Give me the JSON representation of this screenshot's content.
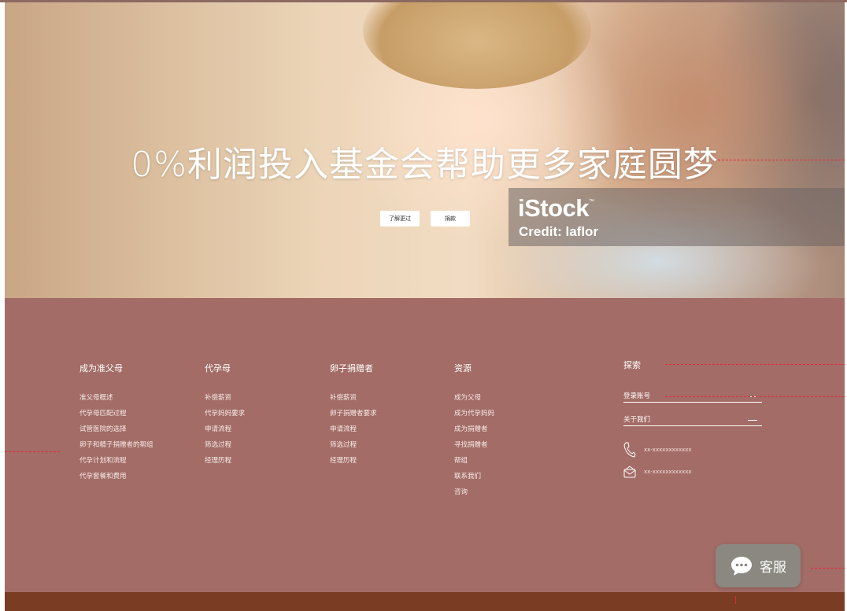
{
  "hero": {
    "title": "0%利润投入基金会帮助更多家庭圆梦",
    "learn_more_label": "了解更过",
    "donate_label": "捐款",
    "watermark": {
      "logo": "iStock",
      "trademark": "™",
      "credit": "Credit: laflor"
    }
  },
  "footer": {
    "columns": [
      {
        "title": "成为准父母",
        "items": [
          "准父母概述",
          "代孕母匹配过程",
          "试管医院的选择",
          "卵子和精子捐赠者的帮组",
          "代孕计划和流程",
          "代孕套餐和费用"
        ]
      },
      {
        "title": "代孕母",
        "items": [
          "补偿薪资",
          "代孕妈妈要求",
          "申请流程",
          "筛选过程",
          "经理历程"
        ]
      },
      {
        "title": "卵子捐赠者",
        "items": [
          "补偿薪资",
          "卵子捐赠者要求",
          "申请流程",
          "筛选过程",
          "经理历程"
        ]
      },
      {
        "title": "资源",
        "items": [
          "成为父母",
          "成为代孕妈妈",
          "成为捐赠者",
          "寻找捐赠者",
          "帮组",
          "联系我们",
          "咨询"
        ]
      }
    ],
    "explore": {
      "title": "探索",
      "login_label": "登录账号",
      "about_label": "关于我们",
      "phone": "xx-xxxxxxxxxxxx",
      "email": "xx-xxxxxxxxxxxx"
    }
  },
  "chat": {
    "label": "客服",
    "icon": "chat-bubble-icon"
  },
  "colors": {
    "footer_bg": "#a36c66",
    "bottom_bar": "#7a3c22",
    "guide": "#e8283c",
    "chat_bg": "#8a8880"
  }
}
